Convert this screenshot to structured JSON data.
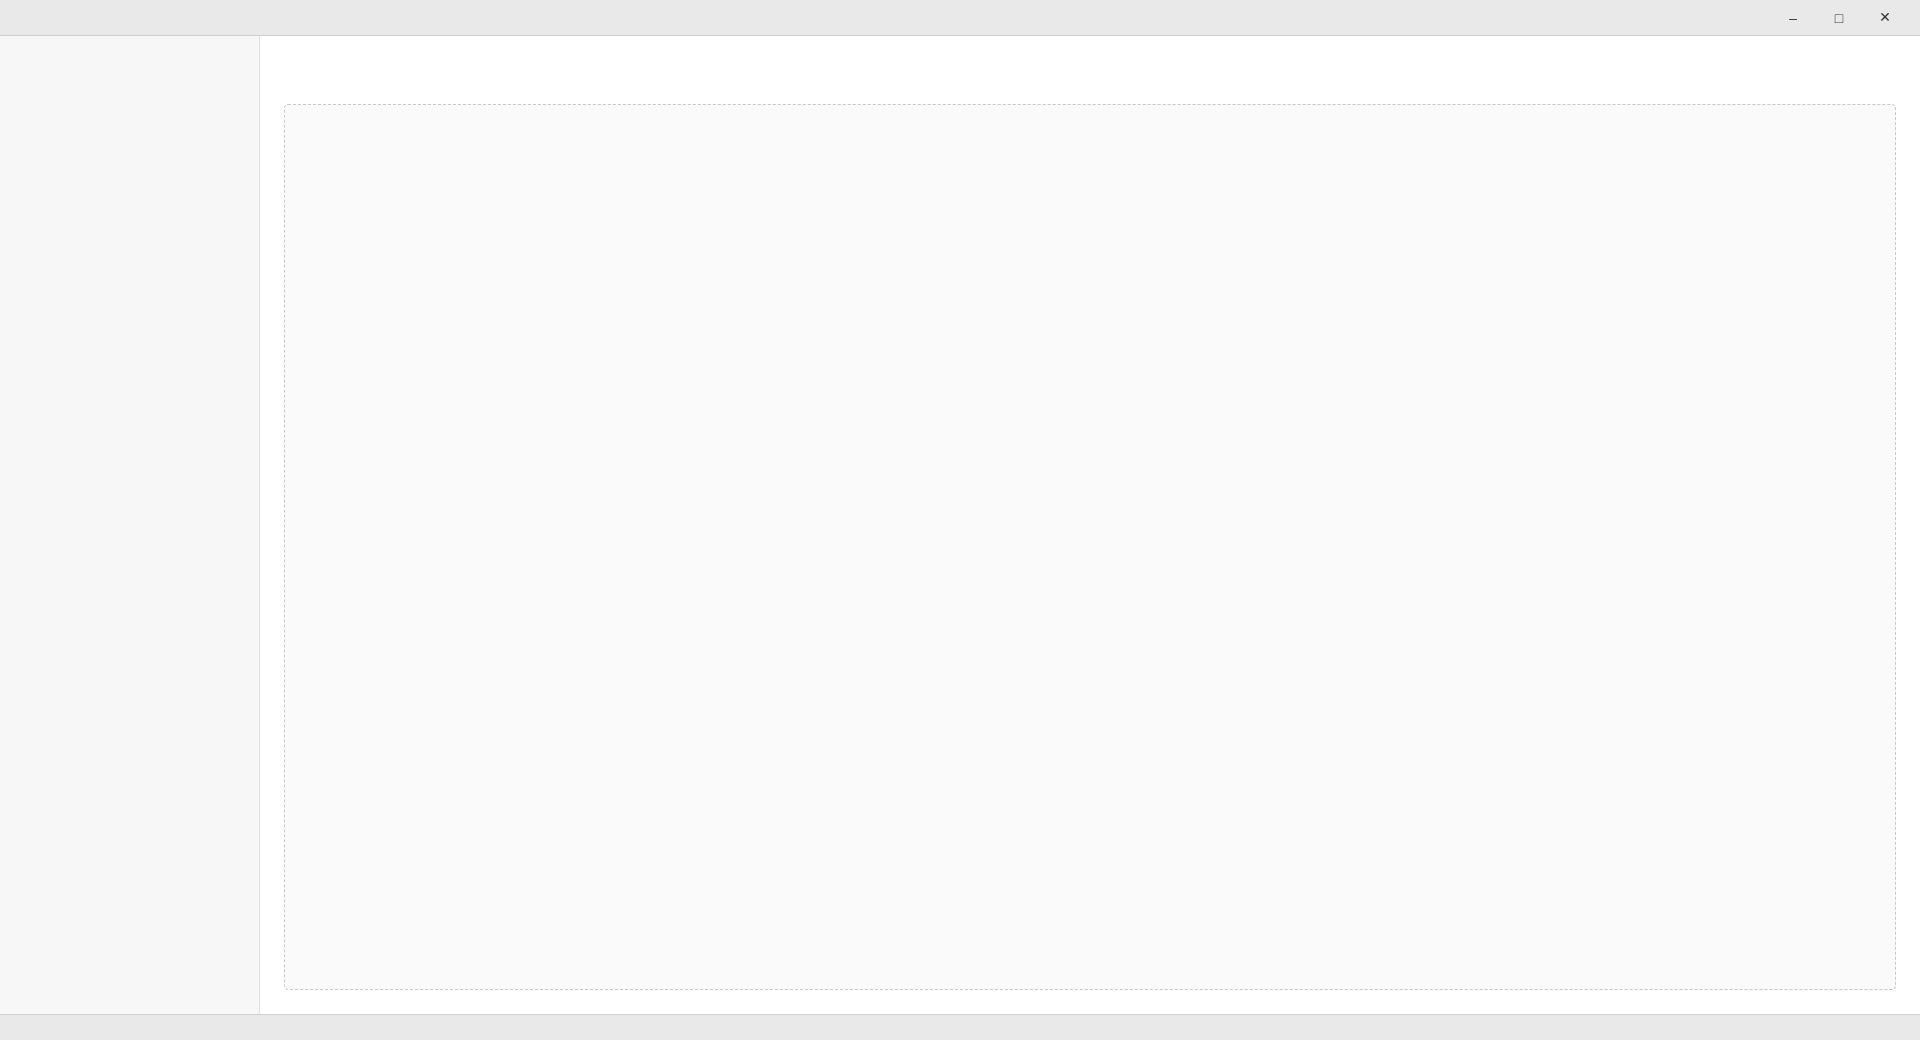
{
  "window": {
    "title": ""
  },
  "main": {
    "title": ""
  },
  "status": {
    "text": ""
  }
}
